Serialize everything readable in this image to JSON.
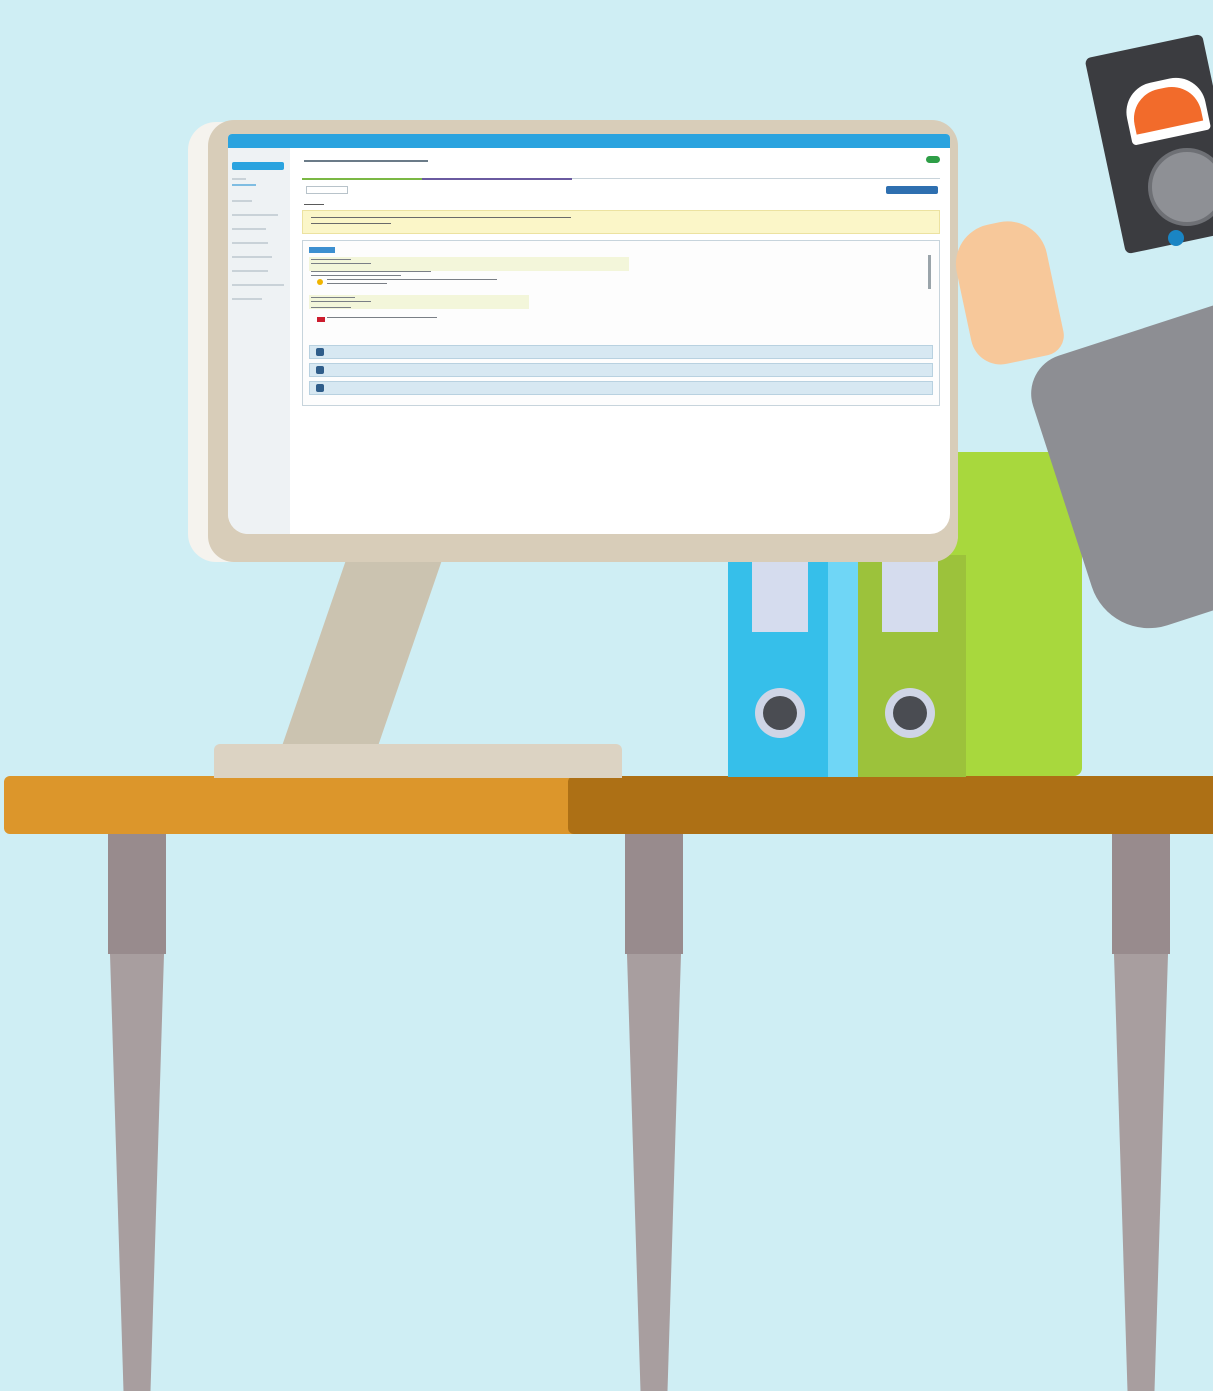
{
  "scene": {
    "background_color": "#cfeef4",
    "desk_colors": [
      "#dc962b",
      "#ad7015"
    ],
    "binder_colors": [
      "#36bfea",
      "#9cc23b",
      "#a8d83d"
    ],
    "monitor_color": "#d8cdb9"
  },
  "app": {
    "brand": "",
    "user_menu": "",
    "sidebar_button": "",
    "page_title": "",
    "tabs": [
      "",
      "",
      "",
      "",
      "",
      ""
    ],
    "accent_color": "#2aa3df",
    "warning_color": "#fbf6c8"
  },
  "icons": {
    "brand": "app-logo-icon",
    "go": "go-button-icon",
    "tools": "toolbar-icons"
  }
}
